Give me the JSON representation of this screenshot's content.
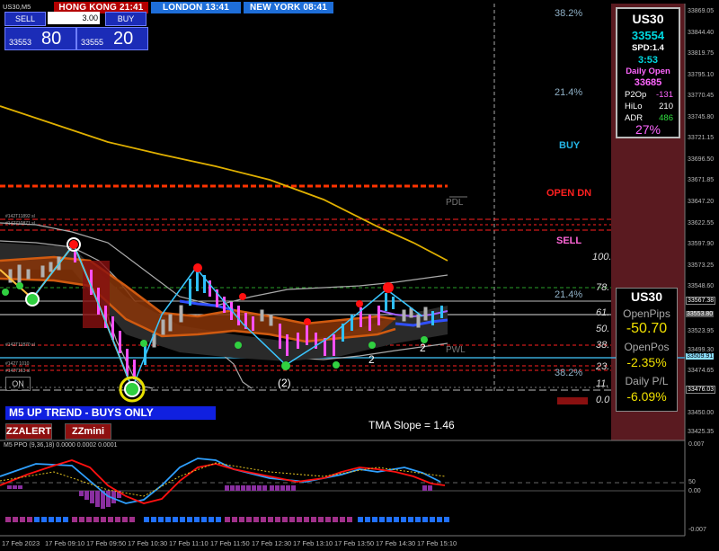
{
  "window": {
    "title": "US30,M5",
    "cities": [
      {
        "label": "HONG KONG 21:41",
        "bg": "#b40000"
      },
      {
        "label": "LONDON  13:41",
        "bg": "#1e6ed8"
      },
      {
        "label": "NEW YORK 08:41",
        "bg": "#1e6ed8"
      }
    ]
  },
  "trade_panel": {
    "sell_label": "SELL",
    "buy_label": "BUY",
    "lot_value": "3.00",
    "sell_small": "33553",
    "sell_big": "80",
    "buy_small": "33555",
    "buy_big": "20"
  },
  "fib_labels": [
    {
      "text": "38.2%",
      "color": "#8fb0c6"
    },
    {
      "text": "21.4%",
      "color": "#8fb0c6"
    },
    {
      "text": "BUY",
      "color": "#25b6e6"
    },
    {
      "text": "OPEN DN",
      "color": "#ff2020"
    },
    {
      "text": "SELL",
      "color": "#ff66d8"
    },
    {
      "text": "PDL",
      "color": "#777"
    },
    {
      "text": "100.",
      "color": "#ddd"
    },
    {
      "text": "78.",
      "color": "#ddd"
    },
    {
      "text": "21.4%",
      "color": "#8fb0c6"
    },
    {
      "text": "61.",
      "color": "#ddd"
    },
    {
      "text": "50.",
      "color": "#ddd"
    },
    {
      "text": "38.",
      "color": "#ddd"
    },
    {
      "text": "PWL",
      "color": "#777"
    },
    {
      "text": "23.",
      "color": "#ddd"
    },
    {
      "text": "38.2%",
      "color": "#8fb0c6"
    },
    {
      "text": "11.",
      "color": "#ddd"
    },
    {
      "text": "0.0",
      "color": "#ddd"
    }
  ],
  "info_panel": {
    "symbol": "US30",
    "price": "33554",
    "spread": "SPD:1.4",
    "timer": "3:53",
    "daily_open_label": "Daily Open",
    "daily_open": "33685",
    "p2op_label": "P2Op",
    "p2op": "-131",
    "hilo_label": "HiLo",
    "hilo": "210",
    "adr_label": "ADR",
    "adr": "486",
    "percent": "27%"
  },
  "position_panel": {
    "symbol": "US30",
    "open_pips_label": "OpenPips",
    "open_pips": "-50.70",
    "open_pos_label": "OpenPos",
    "open_pos": "-2.35%",
    "daily_pl_label": "Daily P/L",
    "daily_pl": "-6.09%"
  },
  "markers": {
    "on_button": "ON",
    "wave_label_1": "2",
    "wave_label_2": "2",
    "wave_label_3": "(2)",
    "tiny_labels": [
      "#142T11892 sl",
      "#142710871 sl",
      "#142T11870 sl",
      "#1427 1010",
      "#1427163 sl"
    ]
  },
  "trend_banner": "M5 UP TREND - BUYS ONLY",
  "buttons": {
    "zzalert": "ZZALERT",
    "zzmini": "ZZmini"
  },
  "tma_slope": "TMA Slope = 1.46",
  "price_axis": [
    "33869.05",
    "33844.40",
    "33819.75",
    "33795.10",
    "33770.45",
    "33745.80",
    "33721.15",
    "33696.50",
    "33671.85",
    "33647.20",
    "33622.55",
    "33597.90",
    "33573.25",
    "33548.60",
    "33523.95",
    "33499.30",
    "33474.65",
    "33450.00",
    "33425.35"
  ],
  "price_tags": [
    {
      "text": "33567.38",
      "color": "#fff",
      "bg": "#000"
    },
    {
      "text": "33553.80",
      "color": "#fff",
      "bg": "#555"
    },
    {
      "text": "33509.91",
      "color": "#000",
      "bg": "#8ce0ff"
    },
    {
      "text": "33476.03",
      "color": "#fff",
      "bg": "#000"
    }
  ],
  "indicator": {
    "title": "M5 PPO (9,36,18) 0.0000 0.0002 0.0001",
    "axis": [
      "0.007",
      "0.00",
      "-0.007"
    ],
    "level": "50"
  },
  "time_axis": [
    "17 Feb 2023",
    "17 Feb 09:10",
    "17 Feb 09:50",
    "17 Feb 10:30",
    "17 Feb 11:10",
    "17 Feb 11:50",
    "17 Feb 12:30",
    "17 Feb 13:10",
    "17 Feb 13:50",
    "17 Feb 14:30",
    "17 Feb 15:10"
  ],
  "colors": {
    "accent_blue": "#1b2cb7",
    "daily_zone": "#5a1a20",
    "tma_orange": "#d05a10",
    "ma_yellow": "#e0b000"
  }
}
